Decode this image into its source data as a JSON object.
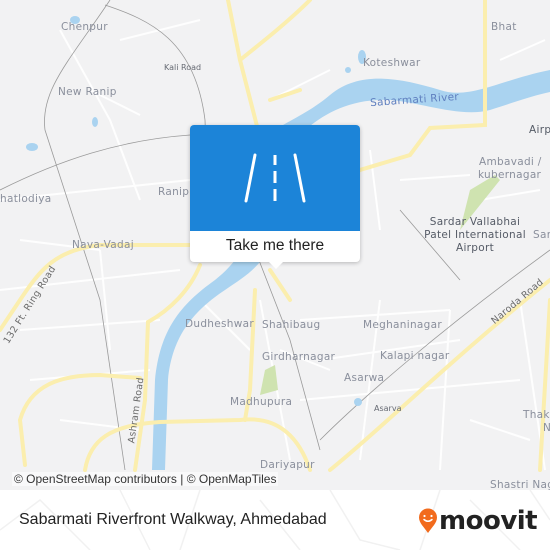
{
  "map": {
    "places": {
      "chenpur": "Chenpur",
      "kali_road": "Kali Road",
      "new_ranip": "New Ranip",
      "ranip": "Ranip",
      "chandlodiya": "hatlodiya",
      "nava_vadaj": "Nava-Vadaj",
      "koteshwar": "Koteshwar",
      "bhat": "Bhat",
      "sabarmati_river": "Sabarmati River",
      "airport_area": "Airp",
      "ambavadi": "Ambavadi /",
      "kubernagar": "kubernagar",
      "airport_line1": "Sardar Vallabhai",
      "airport_line2": "Patel International",
      "airport_line3": "Airport",
      "sardar_nagar": "Sard",
      "ring_road": "132 Ft. Ring Road",
      "dudheshwar": "Dudheshwar",
      "shahibaug": "Shahibaug",
      "meghaninagar": "Meghaninagar",
      "girdharnagar": "Girdharnagar",
      "kalapi_nagar": "Kalapi nagar",
      "asarwa": "Asarwa",
      "asarva_station": "Asarva",
      "madhupura": "Madhupura",
      "ashram_road": "Ashram Road",
      "naroda_road": "Naroda Road",
      "dariyapur": "Dariyapur",
      "thakkar_line1": "Thak",
      "thakkar_line2": "N",
      "shastri_nagar": "Shastri Nag"
    },
    "attribution": "© OpenStreetMap contributors | © OpenMapTiles",
    "colors": {
      "land": "#f2f2f3",
      "water": "#aad3f0",
      "major_road": "#fbeeae",
      "minor_road": "#ffffff",
      "park": "#cfe3b0",
      "rail": "#9a9a9a"
    }
  },
  "popup": {
    "icon": "road-icon",
    "cta_label": "Take me there",
    "color": "#1c84d8"
  },
  "footer": {
    "title": "Sabarmati Riverfront Walkway, Ahmedabad",
    "brand": "moovit",
    "brand_color": "#f26b1d"
  }
}
